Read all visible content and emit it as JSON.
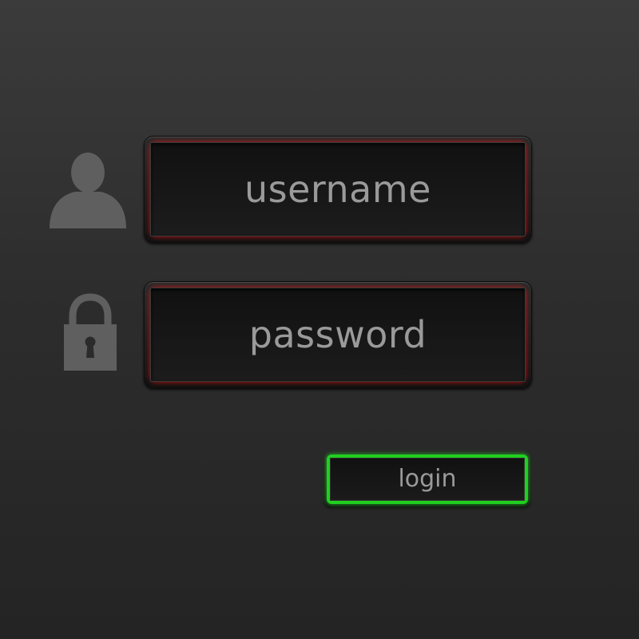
{
  "form": {
    "username_placeholder": "username",
    "password_placeholder": "password",
    "login_label": "login"
  },
  "icons": {
    "user": "user-icon",
    "lock": "lock-icon"
  },
  "colors": {
    "background": "#2d2d2d",
    "field_ring": "#e10f0f",
    "login_ring": "#20d020",
    "icon": "#5f5f5f",
    "text": "#9a9a9a"
  }
}
